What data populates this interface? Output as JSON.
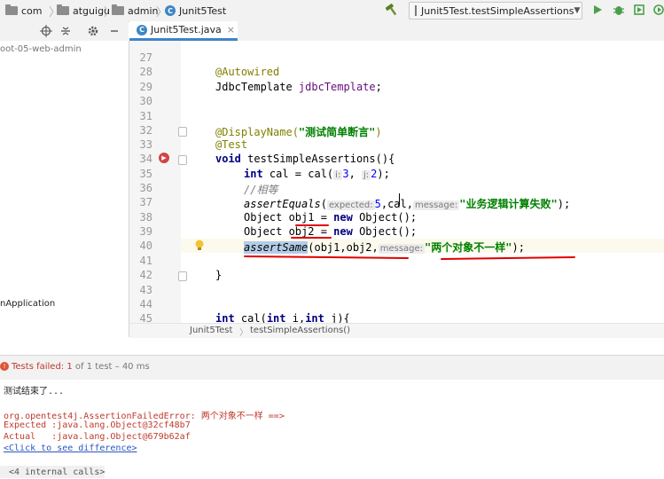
{
  "navbar": {
    "crumbs": [
      "com",
      "atguigu",
      "admin",
      "Junit5Test"
    ],
    "run_config": "Junit5Test.testSimpleAssertions"
  },
  "project": {
    "root_label": "oot-05-web-admin",
    "app_item": "nApplication"
  },
  "editor": {
    "tab_label": "Junit5Test.java",
    "line_numbers": [
      "27",
      "28",
      "29",
      "30",
      "31",
      "32",
      "33",
      "34",
      "35",
      "36",
      "37",
      "38",
      "39",
      "40",
      "41",
      "42",
      "43",
      "44",
      "45"
    ],
    "code": {
      "l28_ann": "@Autowired",
      "l29_type": "JdbcTemplate ",
      "l29_field": "jdbcTemplate",
      "l29_end": ";",
      "l32_ann": "@DisplayName(",
      "l32_str": "\"测试简单断言\"",
      "l32_end": ")",
      "l33_ann": "@Test",
      "l34_kw": "void",
      "l34_rest": " testSimpleAssertions(){",
      "l35_kw": "int",
      "l35_a": " cal = cal(",
      "l35_hint1": "i:",
      "l35_v1": "3",
      "l35_sep": ", ",
      "l35_hint2": "j:",
      "l35_v2": "2",
      "l35_end": ");",
      "l36_comment": "//相等",
      "l37_fn": "assertEquals",
      "l37_open": "(",
      "l37_hint1": "expected:",
      "l37_num": "5",
      "l37_mid": ",cal,",
      "l37_hint2": "message:",
      "l37_str": "\"业务逻辑计算失败\"",
      "l37_end": ");",
      "l38_a": "Object ",
      "l38_var": "obj1",
      "l38_b": " = ",
      "l38_kw": "new",
      "l38_c": " Object();",
      "l39_a": "Object ",
      "l39_var": "obj2",
      "l39_b": " = ",
      "l39_kw": "new",
      "l39_c": " Object();",
      "l40_fn": "assertSame",
      "l40_mid": "(obj1,obj2,",
      "l40_hint": "message:",
      "l40_str": "\"两个对象不一样\"",
      "l40_end": ");",
      "l42": "}",
      "l45_kw1": "int",
      "l45_a": " cal(",
      "l45_kw2": "int",
      "l45_i": " i,",
      "l45_kw3": "int",
      "l45_j": " j){"
    },
    "breadcrumb": [
      "Junit5Test",
      "testSimpleAssertions()"
    ]
  },
  "run": {
    "status_prefix": "Tests failed: ",
    "failed_count": "1",
    "status_detail": " of 1 test – 40 ms",
    "console_lines": {
      "done": "测试结束了...",
      "error": "org.opentest4j.AssertionFailedError: 两个对象不一样 ==>",
      "expected": "Expected :java.lang.Object@32cf48b7",
      "actual": "Actual   :java.lang.Object@679b62af",
      "diff_link": "<Click to see difference>",
      "internal": "<4 internal calls>"
    }
  },
  "colors": {
    "accent": "#4083c9",
    "error_red": "#c0392b",
    "annotation_underline": "#e00000"
  }
}
